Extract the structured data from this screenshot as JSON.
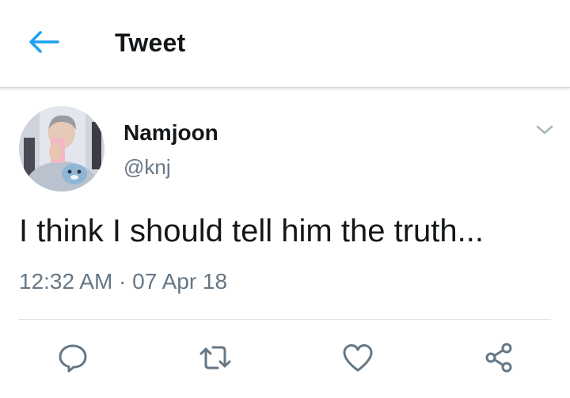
{
  "header": {
    "title": "Tweet",
    "back_icon": "arrow-left-icon"
  },
  "tweet": {
    "display_name": "Namjoon",
    "handle": "@knj",
    "text": "I think I should tell him the truth...",
    "timestamp": "12:32 AM · 07 Apr 18",
    "menu_icon": "chevron-down-icon"
  },
  "actions": [
    {
      "name": "reply",
      "icon": "reply-icon"
    },
    {
      "name": "retweet",
      "icon": "retweet-icon"
    },
    {
      "name": "like",
      "icon": "heart-icon"
    },
    {
      "name": "share",
      "icon": "share-icon"
    }
  ],
  "colors": {
    "accent": "#1da1f2",
    "text_primary": "#14171a",
    "text_secondary": "#657786",
    "icon_gray": "#657786",
    "divider": "#d8dde1"
  }
}
